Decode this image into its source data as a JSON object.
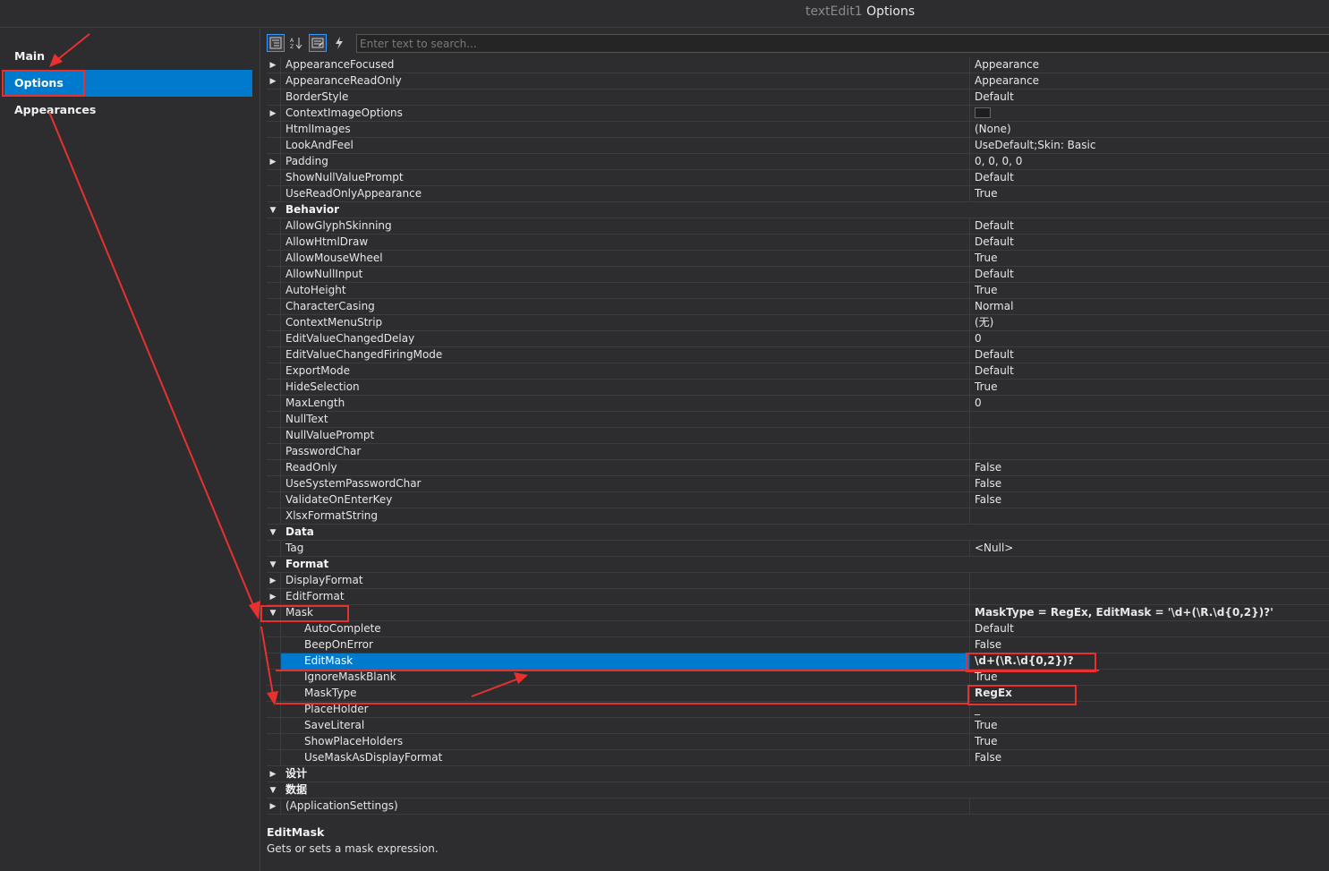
{
  "window": {
    "title_dim": "textEdit1",
    "title_main": "Options"
  },
  "sidebar": {
    "items": [
      {
        "label": "Main",
        "selected": false
      },
      {
        "label": "Options",
        "selected": true
      },
      {
        "label": "Appearances",
        "selected": false
      }
    ]
  },
  "toolbar": {
    "categorized_icon": "categorized-icon",
    "alphabetical_icon": "sort-alphabetical-icon",
    "properties_icon": "properties-icon",
    "events_icon": "lightning-icon",
    "search_placeholder": "Enter text to search..."
  },
  "grid": {
    "rows": [
      {
        "name": "AppearanceFocused",
        "value": "Appearance",
        "kind": "prop",
        "expander": "collapsed"
      },
      {
        "name": "AppearanceReadOnly",
        "value": "Appearance",
        "kind": "prop",
        "expander": "collapsed"
      },
      {
        "name": "BorderStyle",
        "value": "Default",
        "kind": "prop",
        "expander": ""
      },
      {
        "name": "ContextImageOptions",
        "value": "",
        "kind": "prop",
        "expander": "collapsed",
        "swatch": true
      },
      {
        "name": "HtmlImages",
        "value": "(None)",
        "kind": "prop",
        "expander": ""
      },
      {
        "name": "LookAndFeel",
        "value": "UseDefault;Skin: Basic",
        "kind": "prop",
        "expander": ""
      },
      {
        "name": "Padding",
        "value": "0, 0, 0, 0",
        "kind": "prop",
        "expander": "collapsed"
      },
      {
        "name": "ShowNullValuePrompt",
        "value": "Default",
        "kind": "prop",
        "expander": ""
      },
      {
        "name": "UseReadOnlyAppearance",
        "value": "True",
        "kind": "prop",
        "expander": ""
      },
      {
        "name": "Behavior",
        "value": "",
        "kind": "cat",
        "expander": "expanded"
      },
      {
        "name": "AllowGlyphSkinning",
        "value": "Default",
        "kind": "prop",
        "expander": ""
      },
      {
        "name": "AllowHtmlDraw",
        "value": "Default",
        "kind": "prop",
        "expander": ""
      },
      {
        "name": "AllowMouseWheel",
        "value": "True",
        "kind": "prop",
        "expander": ""
      },
      {
        "name": "AllowNullInput",
        "value": "Default",
        "kind": "prop",
        "expander": ""
      },
      {
        "name": "AutoHeight",
        "value": "True",
        "kind": "prop",
        "expander": ""
      },
      {
        "name": "CharacterCasing",
        "value": "Normal",
        "kind": "prop",
        "expander": ""
      },
      {
        "name": "ContextMenuStrip",
        "value": "(无)",
        "kind": "prop",
        "expander": ""
      },
      {
        "name": "EditValueChangedDelay",
        "value": "0",
        "kind": "prop",
        "expander": ""
      },
      {
        "name": "EditValueChangedFiringMode",
        "value": "Default",
        "kind": "prop",
        "expander": ""
      },
      {
        "name": "ExportMode",
        "value": "Default",
        "kind": "prop",
        "expander": ""
      },
      {
        "name": "HideSelection",
        "value": "True",
        "kind": "prop",
        "expander": ""
      },
      {
        "name": "MaxLength",
        "value": "0",
        "kind": "prop",
        "expander": ""
      },
      {
        "name": "NullText",
        "value": "",
        "kind": "prop",
        "expander": ""
      },
      {
        "name": "NullValuePrompt",
        "value": "",
        "kind": "prop",
        "expander": ""
      },
      {
        "name": "PasswordChar",
        "value": "",
        "kind": "prop",
        "expander": ""
      },
      {
        "name": "ReadOnly",
        "value": "False",
        "kind": "prop",
        "expander": ""
      },
      {
        "name": "UseSystemPasswordChar",
        "value": "False",
        "kind": "prop",
        "expander": ""
      },
      {
        "name": "ValidateOnEnterKey",
        "value": "False",
        "kind": "prop",
        "expander": ""
      },
      {
        "name": "XlsxFormatString",
        "value": "",
        "kind": "prop",
        "expander": ""
      },
      {
        "name": "Data",
        "value": "",
        "kind": "cat",
        "expander": "expanded"
      },
      {
        "name": "Tag",
        "value": "<Null>",
        "kind": "prop",
        "expander": ""
      },
      {
        "name": "Format",
        "value": "",
        "kind": "cat",
        "expander": "expanded"
      },
      {
        "name": "DisplayFormat",
        "value": "",
        "kind": "prop",
        "expander": "collapsed"
      },
      {
        "name": "EditFormat",
        "value": "",
        "kind": "prop",
        "expander": "collapsed"
      },
      {
        "name": "Mask",
        "value": "MaskType = RegEx, EditMask = '\\d+(\\R.\\d{0,2})?'",
        "kind": "prop",
        "expander": "expanded",
        "bold_value": true
      },
      {
        "name": "AutoComplete",
        "value": "Default",
        "kind": "sub",
        "expander": ""
      },
      {
        "name": "BeepOnError",
        "value": "False",
        "kind": "sub",
        "expander": ""
      },
      {
        "name": "EditMask",
        "value": "\\d+(\\R.\\d{0,2})?",
        "kind": "sub",
        "expander": "",
        "selected": true,
        "bold_value": true
      },
      {
        "name": "IgnoreMaskBlank",
        "value": "True",
        "kind": "sub",
        "expander": ""
      },
      {
        "name": "MaskType",
        "value": "RegEx",
        "kind": "sub",
        "expander": "",
        "bold_value": true
      },
      {
        "name": "PlaceHolder",
        "value": "_",
        "kind": "sub",
        "expander": ""
      },
      {
        "name": "SaveLiteral",
        "value": "True",
        "kind": "sub",
        "expander": ""
      },
      {
        "name": "ShowPlaceHolders",
        "value": "True",
        "kind": "sub",
        "expander": ""
      },
      {
        "name": "UseMaskAsDisplayFormat",
        "value": "False",
        "kind": "sub",
        "expander": ""
      },
      {
        "name": "设计",
        "value": "",
        "kind": "cat",
        "expander": "collapsed"
      },
      {
        "name": "数据",
        "value": "",
        "kind": "cat",
        "expander": "expanded"
      },
      {
        "name": "(ApplicationSettings)",
        "value": "",
        "kind": "prop",
        "expander": "collapsed"
      }
    ]
  },
  "description": {
    "title": "EditMask",
    "text": "Gets or sets a mask expression."
  },
  "colors": {
    "accent": "#007acc",
    "annotation": "#e8312f",
    "background": "#2d2d30"
  }
}
